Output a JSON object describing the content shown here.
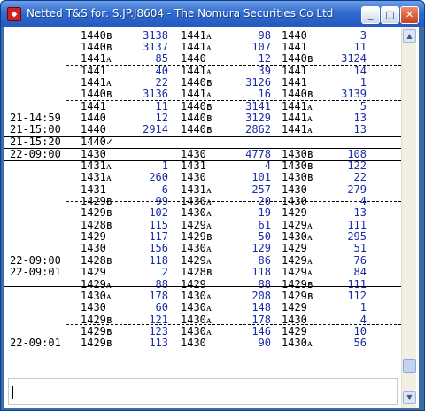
{
  "window": {
    "title": "Netted T&S for: S.JP.J8604 - The Nomura Securities Co Ltd",
    "min_glyph": "_",
    "max_glyph": "□",
    "close_glyph": "✕"
  },
  "scrollbar": {
    "up_glyph": "▲",
    "down_glyph": "▼"
  },
  "input": {
    "value": ""
  },
  "rows": [
    {
      "time": "",
      "p1": "1440ʙ",
      "q1": "3138",
      "p2": "1441ᴀ",
      "q2": "98",
      "p3": "1440",
      "q3": "3"
    },
    {
      "time": "",
      "p1": "1440ʙ",
      "q1": "3137",
      "p2": "1441ᴀ",
      "q2": "107",
      "p3": "1441",
      "q3": "11"
    },
    {
      "time": "",
      "p1": "1441ᴀ",
      "q1": "85",
      "p2": "1440",
      "q2": "12",
      "p3": "1440ʙ",
      "q3": "3124"
    },
    {
      "time": "",
      "p1": "1441",
      "q1": "40",
      "p2": "1441ᴀ",
      "q2": "39",
      "p3": "1441",
      "q3": "14"
    },
    {
      "time": "",
      "p1": "1441ᴀ",
      "q1": "22",
      "p2": "1440ʙ",
      "q2": "3126",
      "p3": "1441",
      "q3": "1"
    },
    {
      "time": "",
      "p1": "1440ʙ",
      "q1": "3136",
      "p2": "1441ᴀ",
      "q2": "16",
      "p3": "1440ʙ",
      "q3": "3139"
    },
    {
      "time": "",
      "p1": "1441",
      "q1": "11",
      "p2": "1440ʙ",
      "q2": "3141",
      "p3": "1441ᴀ",
      "q3": "5"
    },
    {
      "time": "21-14:59",
      "p1": "1440",
      "q1": "12",
      "p2": "1440ʙ",
      "q2": "3129",
      "p3": "1441ᴀ",
      "q3": "13"
    },
    {
      "time": "21-15:00",
      "p1": "1440",
      "q1": "2914",
      "p2": "1440ʙ",
      "q2": "2862",
      "p3": "1441ᴀ",
      "q3": "13"
    },
    {
      "time": "21-15:20",
      "p1": "1440✓",
      "q1": "",
      "p2": "",
      "q2": "",
      "p3": "",
      "q3": ""
    },
    {
      "time": "22-09:00",
      "p1": "1430",
      "q1": "",
      "p2": "1430",
      "q2": "4778",
      "p3": "1430ʙ",
      "q3": "108"
    },
    {
      "time": "",
      "p1": "1431ᴀ",
      "q1": "1",
      "p2": "1431",
      "q2": "4",
      "p3": "1430ʙ",
      "q3": "122"
    },
    {
      "time": "",
      "p1": "1431ᴀ",
      "q1": "260",
      "p2": "1430",
      "q2": "101",
      "p3": "1430ʙ",
      "q3": "22"
    },
    {
      "time": "",
      "p1": "1431",
      "q1": "6",
      "p2": "1431ᴀ",
      "q2": "257",
      "p3": "1430",
      "q3": "279"
    },
    {
      "time": "",
      "p1": "1429ʙ",
      "q1": "99",
      "p2": "1430ᴀ",
      "q2": "20",
      "p3": "1430",
      "q3": "4"
    },
    {
      "time": "",
      "p1": "1429ʙ",
      "q1": "102",
      "p2": "1430ᴀ",
      "q2": "19",
      "p3": "1429",
      "q3": "13"
    },
    {
      "time": "",
      "p1": "1428ʙ",
      "q1": "115",
      "p2": "1429ᴀ",
      "q2": "61",
      "p3": "1429ᴀ",
      "q3": "111"
    },
    {
      "time": "",
      "p1": "1429",
      "q1": "117",
      "p2": "1429ʙ",
      "q2": "50",
      "p3": "1430ᴀ",
      "q3": "295"
    },
    {
      "time": "",
      "p1": "1430",
      "q1": "156",
      "p2": "1430ᴀ",
      "q2": "129",
      "p3": "1429",
      "q3": "51"
    },
    {
      "time": "22-09:00",
      "p1": "1428ʙ",
      "q1": "118",
      "p2": "1429ᴀ",
      "q2": "86",
      "p3": "1429ᴀ",
      "q3": "76"
    },
    {
      "time": "22-09:01",
      "p1": "1429",
      "q1": "2",
      "p2": "1428ʙ",
      "q2": "118",
      "p3": "1429ᴀ",
      "q3": "84"
    },
    {
      "time": "",
      "p1": "1429ᴀ",
      "q1": "88",
      "p2": "1429",
      "q2": "88",
      "p3": "1429ʙ",
      "q3": "111"
    },
    {
      "time": "",
      "p1": "1430ᴀ",
      "q1": "178",
      "p2": "1430ᴀ",
      "q2": "208",
      "p3": "1429ʙ",
      "q3": "112"
    },
    {
      "time": "",
      "p1": "1430",
      "q1": "60",
      "p2": "1430ᴀ",
      "q2": "148",
      "p3": "1429",
      "q3": "1"
    },
    {
      "time": "",
      "p1": "1429ʙ",
      "q1": "121",
      "p2": "1430ᴀ",
      "q2": "178",
      "p3": "1430",
      "q3": "4"
    },
    {
      "time": "",
      "p1": "1429ʙ",
      "q1": "123",
      "p2": "1430ᴀ",
      "q2": "146",
      "p3": "1429",
      "q3": "10"
    },
    {
      "time": "22-09:01",
      "p1": "1429ʙ",
      "q1": "113",
      "p2": "1430",
      "q2": "90",
      "p3": "1430ᴀ",
      "q3": "56"
    }
  ],
  "colors": {
    "quantity": "#1a2aa8",
    "titlebar": "#2f6bd1"
  }
}
